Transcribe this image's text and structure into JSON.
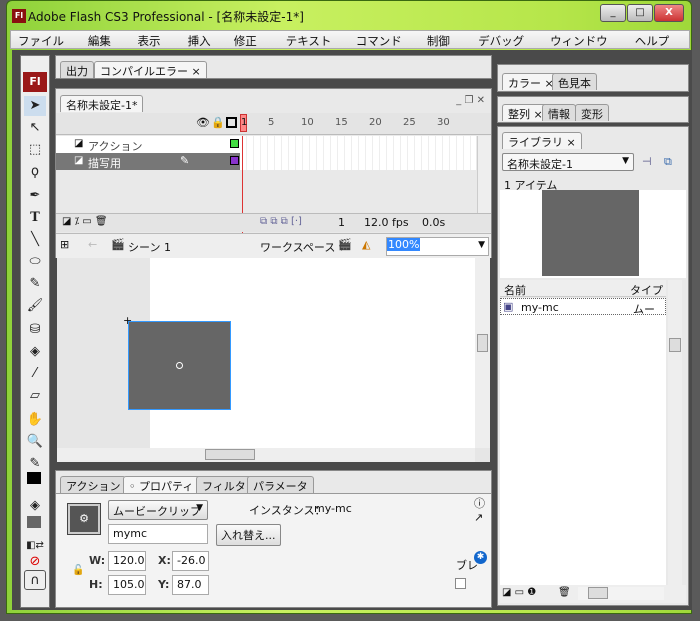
{
  "window": {
    "title": "Adobe Flash CS3 Professional - [名称未設定-1*]",
    "app_icon": "Fl",
    "minimize": "_",
    "maximize": "□",
    "close": "X"
  },
  "menu": [
    "ファイル(F)",
    "編集(E)",
    "表示(V)",
    "挿入(I)",
    "修正(M)",
    "テキスト(T)",
    "コマンド(C)",
    "制御(O)",
    "デバッグ(D)",
    "ウィンドウ(W)",
    "ヘルプ(H)"
  ],
  "output_tabs": [
    "出力",
    "コンパイルエラー"
  ],
  "document_tab": "名称未設定-1*",
  "timeline": {
    "frame_numbers": [
      "1",
      "5",
      "10",
      "15",
      "20",
      "25",
      "30"
    ],
    "layers": [
      {
        "name": "アクション",
        "color": "#44dd44",
        "selected": false
      },
      {
        "name": "描写用",
        "color": "#8833cc",
        "selected": true
      }
    ],
    "current_frame": "1",
    "fps": "12.0 fps",
    "time": "0.0s"
  },
  "editbar": {
    "scene": "シーン 1",
    "workspace": "ワークスペース",
    "zoom": "100%"
  },
  "tools": {
    "logo": "Fl"
  },
  "properties": {
    "tabs": [
      "アクション",
      "プロパティ",
      "フィルタ",
      "パラメータ"
    ],
    "symbol_type": "ムービークリップ",
    "instance_label": "インスタンス：",
    "instance_of": "my-mc",
    "instance_name": "mymc",
    "swap_button": "入れ替え...",
    "w_label": "W:",
    "w": "120.0",
    "h_label": "H:",
    "h": "105.0",
    "x_label": "X:",
    "x": "-26.0",
    "y_label": "Y:",
    "y": "87.0",
    "blend_label": "ブレ"
  },
  "right": {
    "color_tabs": [
      "カラー",
      "色見本"
    ],
    "align_tabs": [
      "整列",
      "情報",
      "変形"
    ],
    "library_tab": "ライブラリ",
    "library_doc": "名称未設定-1",
    "item_count": "1 アイテム",
    "col_name": "名前",
    "col_type": "タイプ",
    "items": [
      {
        "name": "my-mc",
        "type": "ムービー"
      }
    ]
  }
}
